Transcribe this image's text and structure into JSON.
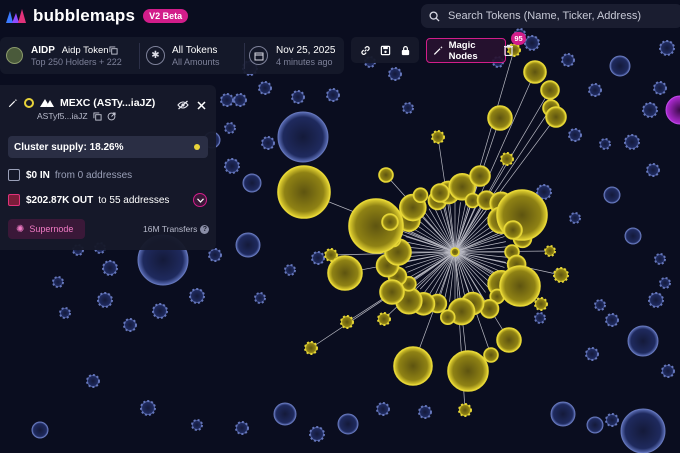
{
  "app": {
    "name": "bubblemaps",
    "badge": "V2 Beta"
  },
  "search": {
    "placeholder": "Search Tokens (Name, Ticker, Address)",
    "icon": "search-icon"
  },
  "token": {
    "ticker": "AIDP",
    "name": "Aidp Token",
    "holders": "Top 250 Holders + 222"
  },
  "filters": {
    "tokens_title": "All Tokens",
    "tokens_sub": "All Amounts",
    "date": "Nov 25, 2025",
    "date_sub": "4 minutes ago"
  },
  "toolbar": {
    "icons": [
      "link-icon",
      "save-icon",
      "lock-icon"
    ],
    "magic_label": "Magic Nodes",
    "magic_count": "95"
  },
  "panel": {
    "title": "MEXC (ASTy...iaJZ)",
    "address": "ASTyf5...iaJZ",
    "cluster": "Cluster supply: 18.26%",
    "in_amount": "$0 IN",
    "in_sub": "from 0 addresses",
    "out_amount": "$202.87K OUT",
    "out_sub": "to 55 addresses",
    "supernode": "Supernode",
    "transfers": "16M Transfers"
  },
  "colors": {
    "background": "#0a0d1f",
    "accent": "#d21d8a",
    "node_yellow": "#c9b81e",
    "node_blue": "#3d4a8a"
  }
}
